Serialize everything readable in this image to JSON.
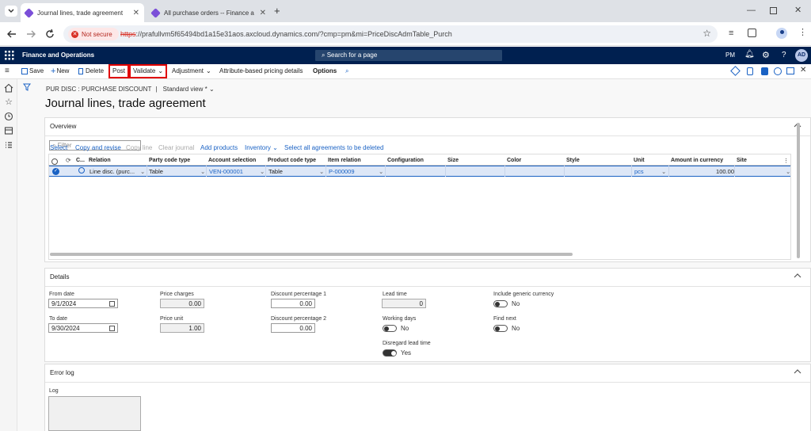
{
  "browser": {
    "tabs": [
      {
        "title": "Journal lines, trade agreement"
      },
      {
        "title": "All purchase orders -- Finance a"
      }
    ],
    "not_secure": "Not secure",
    "url_scheme": "https",
    "url_rest": "://prafullvm5f65494bd1a15e31aos.axcloud.dynamics.com/?cmp=pm&mi=PriceDiscAdmTable_Purch"
  },
  "nav": {
    "brand": "Finance and Operations",
    "search_placeholder": "Search for a page",
    "company": "PM",
    "help": "?",
    "avatar": "AD"
  },
  "actions": {
    "save": "Save",
    "new": "New",
    "delete": "Delete",
    "post": "Post",
    "validate": "Validate",
    "adjustment": "Adjustment",
    "attribute": "Attribute-based pricing details",
    "options": "Options"
  },
  "page": {
    "breadcrumb": "PUR DISC : PURCHASE DISCOUNT",
    "view": "Standard view *",
    "title": "Journal lines, trade agreement"
  },
  "overview": {
    "header": "Overview",
    "filter_placeholder": "Filter",
    "toolbar": {
      "select": "Select",
      "copy_revise": "Copy and revise",
      "copy_line": "Copy line",
      "clear_journal": "Clear journal",
      "add_products": "Add products",
      "inventory": "Inventory",
      "select_all": "Select all agreements to be deleted"
    },
    "columns": {
      "c": "C...",
      "relation": "Relation",
      "party_code_type": "Party code type",
      "account_selection": "Account selection",
      "product_code_type": "Product code type",
      "item_relation": "Item relation",
      "configuration": "Configuration",
      "size": "Size",
      "color": "Color",
      "style": "Style",
      "unit": "Unit",
      "amount": "Amount in currency",
      "site": "Site"
    },
    "row": {
      "relation": "Line disc. (purc...",
      "party_code_type": "Table",
      "account_selection": "VEN-000001",
      "product_code_type": "Table",
      "item_relation": "P-000009",
      "unit": "pcs",
      "amount": "100.00"
    }
  },
  "details": {
    "header": "Details",
    "from_date_label": "From date",
    "from_date": "9/1/2024",
    "to_date_label": "To date",
    "to_date": "9/30/2024",
    "price_charges_label": "Price charges",
    "price_charges": "0.00",
    "price_unit_label": "Price unit",
    "price_unit": "1.00",
    "disc1_label": "Discount percentage 1",
    "disc1": "0.00",
    "disc2_label": "Discount percentage 2",
    "disc2": "0.00",
    "lead_time_label": "Lead time",
    "lead_time": "0",
    "working_days_label": "Working days",
    "working_days": "No",
    "disregard_label": "Disregard lead time",
    "disregard": "Yes",
    "generic_currency_label": "Include generic currency",
    "generic_currency": "No",
    "find_next_label": "Find next",
    "find_next": "No"
  },
  "error_log": {
    "header": "Error log",
    "log_label": "Log"
  },
  "colors": {
    "nav_bg": "#002050",
    "accent": "#1a62c4",
    "highlight_outline": "#e00000",
    "selected_row": "#dde7f7"
  }
}
